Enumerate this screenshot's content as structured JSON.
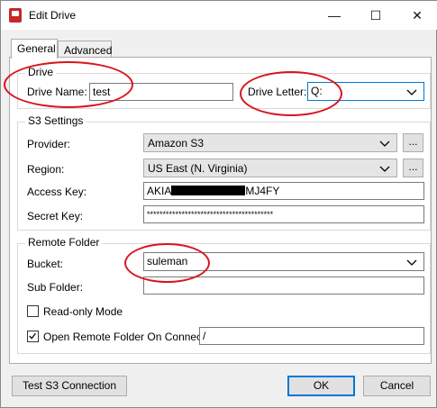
{
  "window": {
    "title": "Edit Drive",
    "controls": {
      "minimize": "—",
      "maximize": "☐",
      "close": "✕"
    }
  },
  "tabs": [
    {
      "label": "General"
    },
    {
      "label": "Advanced"
    }
  ],
  "drive": {
    "legend": "Drive",
    "name_label": "Drive Name:",
    "name_value": "test",
    "letter_label": "Drive Letter:",
    "letter_value": "Q:"
  },
  "s3": {
    "legend": "S3 Settings",
    "provider_label": "Provider:",
    "provider_value": "Amazon S3",
    "region_label": "Region:",
    "region_value": "US East (N. Virginia)",
    "browse_label": "...",
    "access_key_label": "Access Key:",
    "access_key_prefix": "AKIA",
    "access_key_suffix": "MJ4FY",
    "secret_key_label": "Secret Key:",
    "secret_key_value": "****************************************"
  },
  "remote": {
    "legend": "Remote Folder",
    "bucket_label": "Bucket:",
    "bucket_value": "suleman",
    "subfolder_label": "Sub Folder:",
    "subfolder_value": "",
    "readonly_label": "Read-only Mode",
    "readonly_checked": false,
    "open_label": "Open Remote Folder On Connect:",
    "open_checked": true,
    "open_value": "/"
  },
  "footer": {
    "test_label": "Test S3 Connection",
    "ok_label": "OK",
    "cancel_label": "Cancel"
  },
  "colors": {
    "annotation": "#d8141f",
    "focus": "#0078d7"
  }
}
